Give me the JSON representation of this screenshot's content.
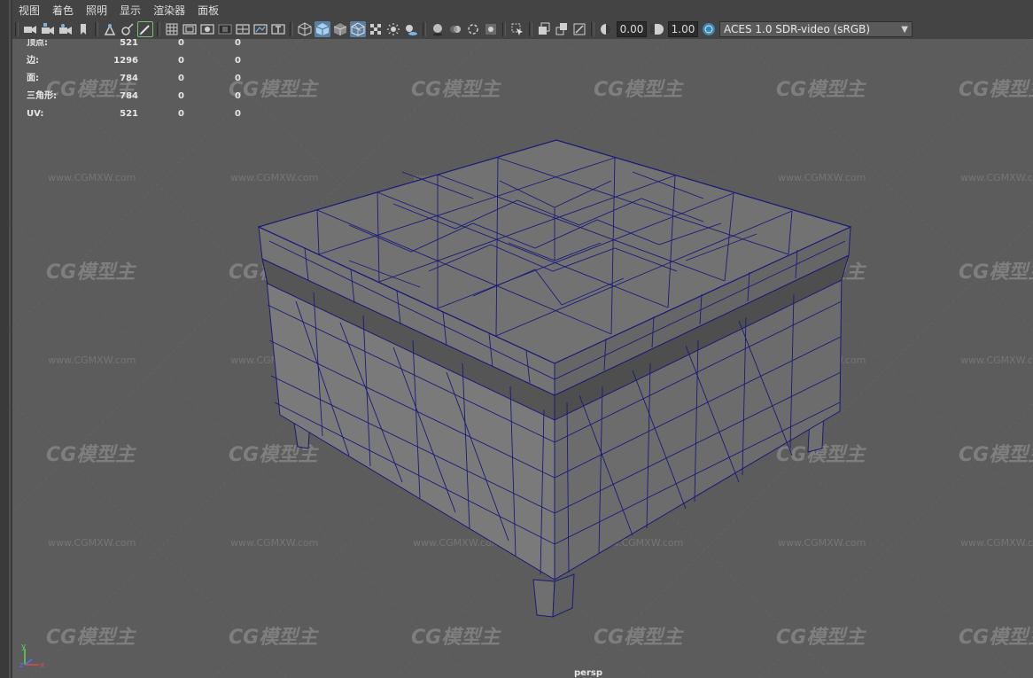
{
  "menu": {
    "items": [
      "视图",
      "着色",
      "照明",
      "显示",
      "渲染器",
      "面板"
    ]
  },
  "toolbar": {
    "exposure_value": "0.00",
    "gamma_value": "1.00",
    "color_space": "ACES 1.0 SDR-video (sRGB)"
  },
  "hud": {
    "rows": [
      {
        "label": "顶点:",
        "v1": "521",
        "v2": "0",
        "v3": "0"
      },
      {
        "label": "边:",
        "v1": "1296",
        "v2": "0",
        "v3": "0"
      },
      {
        "label": "面:",
        "v1": "784",
        "v2": "0",
        "v3": "0"
      },
      {
        "label": "三角形:",
        "v1": "784",
        "v2": "0",
        "v3": "0"
      },
      {
        "label": "UV:",
        "v1": "521",
        "v2": "0",
        "v3": "0"
      }
    ]
  },
  "camera_label": "persp",
  "watermark": {
    "logo": "CG模型主",
    "url": "www.CGMXW.com"
  },
  "axis": {
    "x": "x",
    "y": "y",
    "z": "z"
  },
  "colors": {
    "viewport_bg": "#5c5c5c",
    "wire": "#1a1a78",
    "active_button": "#5d7fa0"
  }
}
